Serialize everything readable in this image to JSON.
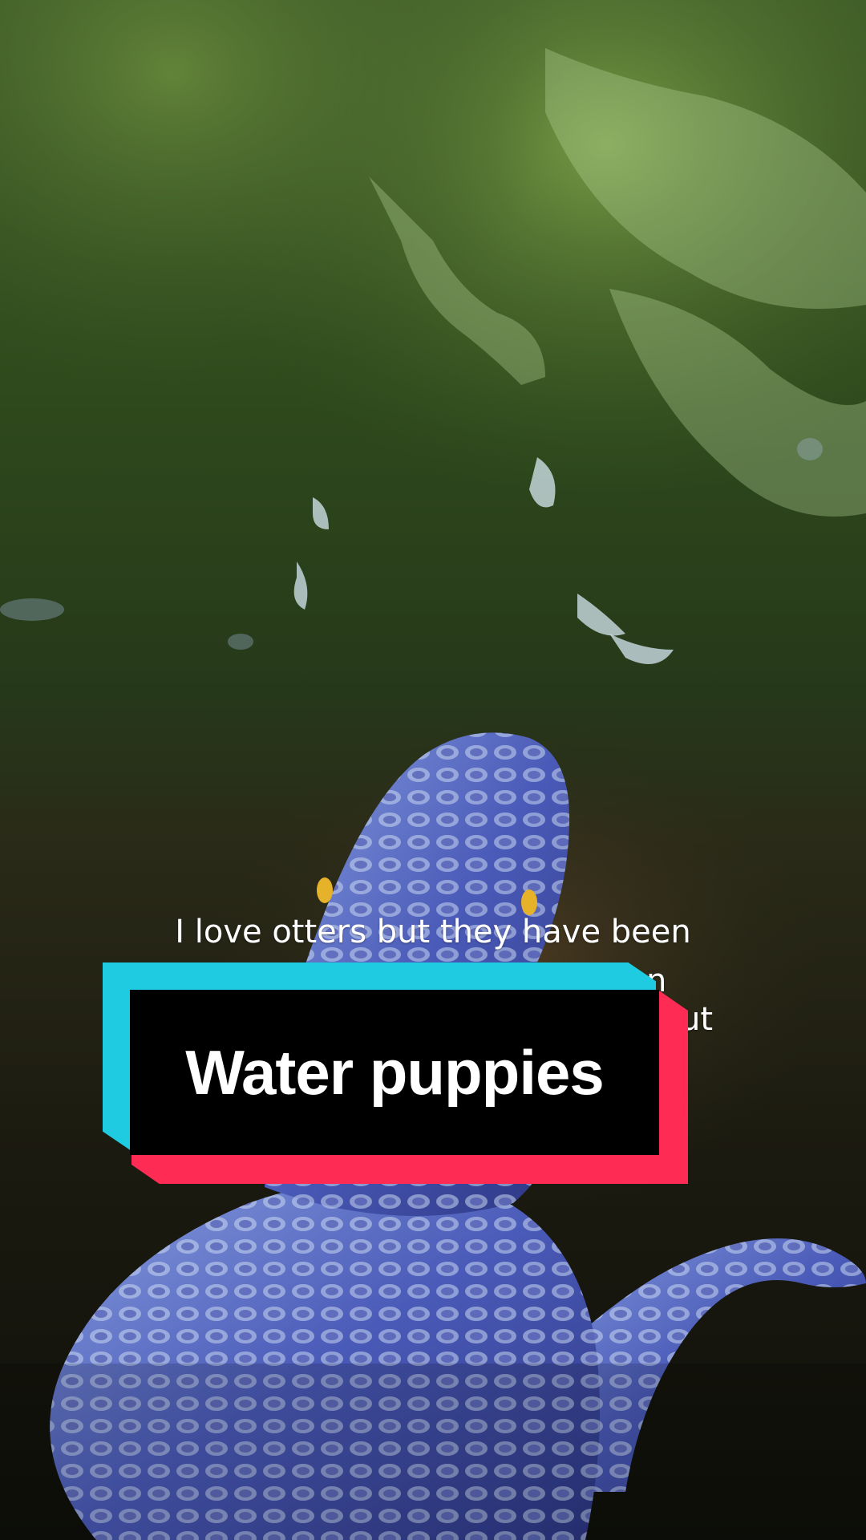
{
  "caption": {
    "line1": "I love otters but they have been",
    "line2": "n",
    "line3": "ut"
  },
  "sticker": {
    "title": "Water puppies",
    "colors": {
      "cyan": "#1ecbe1",
      "red": "#fe2c55",
      "plate": "#000000"
    }
  },
  "scene": {
    "subject": "alligator-toy-in-water"
  }
}
